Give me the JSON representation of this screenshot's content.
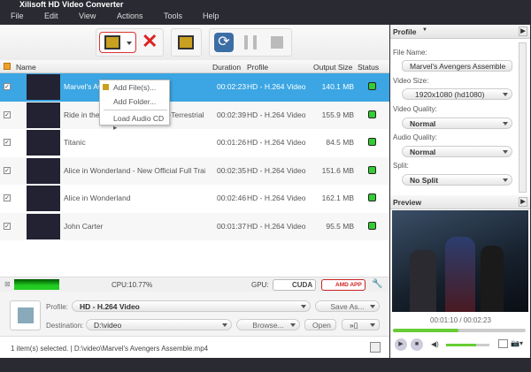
{
  "app": {
    "title": "Xilisoft HD Video Converter"
  },
  "menu": [
    "File",
    "Edit",
    "View",
    "Actions",
    "Tools",
    "Help"
  ],
  "add_menu": {
    "items": [
      "Add File(s)...",
      "Add Folder...",
      "Load Audio CD"
    ]
  },
  "columns": [
    "Name",
    "Duration",
    "Profile",
    "Output Size",
    "Status"
  ],
  "rows": [
    {
      "name": "Marvel's Avengers Assemble",
      "name_visible": "Marvel's Av",
      "duration": "00:02:23",
      "profile": "HD - H.264 Video",
      "size": "140.1 MB",
      "selected": true
    },
    {
      "name": "Ride in the Sky - E.T. The Extra-Terrestrial (...",
      "duration": "00:02:39",
      "profile": "HD - H.264 Video",
      "size": "155.9 MB"
    },
    {
      "name": "Titanic",
      "duration": "00:01:26",
      "profile": "HD - H.264 Video",
      "size": "84.5 MB"
    },
    {
      "name": "Alice in Wonderland - New Official Full Trai...",
      "duration": "00:02:35",
      "profile": "HD - H.264 Video",
      "size": "151.6 MB"
    },
    {
      "name": "Alice in Wonderland",
      "duration": "00:02:46",
      "profile": "HD - H.264 Video",
      "size": "162.1 MB"
    },
    {
      "name": "John Carter",
      "duration": "00:01:37",
      "profile": "HD - H.264 Video",
      "size": "95.5 MB"
    }
  ],
  "cpu": "CPU:10.77%",
  "gpu": {
    "label": "GPU:",
    "cuda": "CUDA",
    "amd": "AMD APP"
  },
  "output": {
    "profile_label": "Profile:",
    "profile": "HD - H.264 Video",
    "save_as": "Save As...",
    "dest_label": "Destination:",
    "dest": "D:\\video",
    "browse": "Browse...",
    "open": "Open"
  },
  "status": "1 item(s) selected. | D:\\video\\Marvel's Avengers Assemble.mp4",
  "profile_panel": {
    "title": "Profile",
    "file_name_label": "File Name:",
    "file_name": "Marvel's Avengers Assemble",
    "video_size_label": "Video Size:",
    "video_size": "1920x1080 (hd1080)",
    "video_quality_label": "Video Quality:",
    "video_quality": "Normal",
    "audio_quality_label": "Audio Quality:",
    "audio_quality": "Normal",
    "split_label": "Split:",
    "split": "No Split"
  },
  "preview": {
    "title": "Preview",
    "time": "00:01:10 / 00:02:23",
    "progress": 0.49,
    "volume": 0.7
  },
  "colors": {
    "selection": "#3ba6e3",
    "status_ok": "#33cc33",
    "menubar": "#2a2a33"
  }
}
